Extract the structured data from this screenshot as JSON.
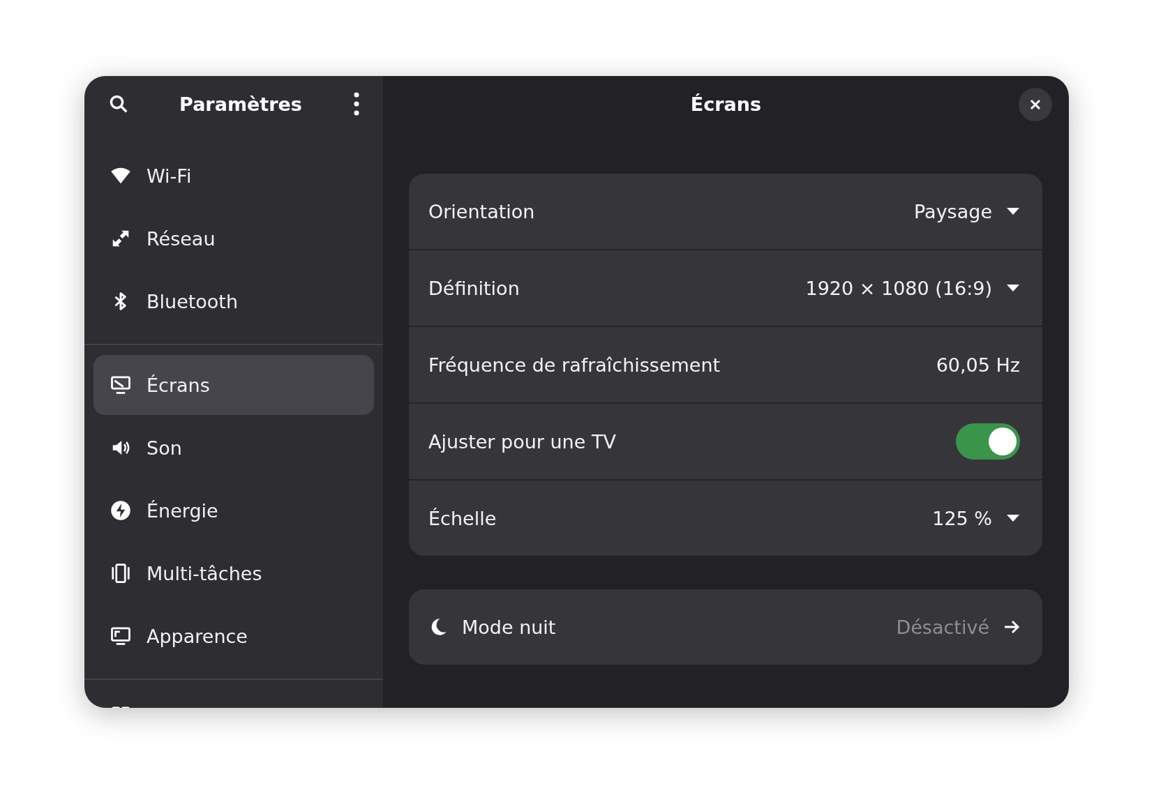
{
  "sidebar": {
    "title": "Paramètres",
    "sections": [
      {
        "items": [
          {
            "label": "Wi-Fi",
            "selected": false
          },
          {
            "label": "Réseau",
            "selected": false
          },
          {
            "label": "Bluetooth",
            "selected": false
          }
        ]
      },
      {
        "items": [
          {
            "label": "Écrans",
            "selected": true
          },
          {
            "label": "Son",
            "selected": false
          },
          {
            "label": "Énergie",
            "selected": false
          },
          {
            "label": "Multi-tâches",
            "selected": false
          },
          {
            "label": "Apparence",
            "selected": false
          }
        ]
      },
      {
        "items": [
          {
            "selected": false
          }
        ]
      }
    ]
  },
  "page": {
    "title": "Écrans",
    "groups": [
      {
        "rows": [
          {
            "kind": "dropdown",
            "label": "Orientation",
            "value": "Paysage"
          },
          {
            "kind": "dropdown",
            "label": "Définition",
            "value": "1920 × 1080 (16:9)"
          },
          {
            "kind": "value",
            "label": "Fréquence de rafraîchissement",
            "value": "60,05 Hz"
          },
          {
            "kind": "switch",
            "label": "Ajuster pour une TV",
            "on": true
          },
          {
            "kind": "dropdown",
            "label": "Échelle",
            "value": "125 %"
          }
        ]
      },
      {
        "rows": [
          {
            "kind": "link",
            "label": "Mode nuit",
            "value": "Désactivé"
          }
        ]
      }
    ]
  }
}
